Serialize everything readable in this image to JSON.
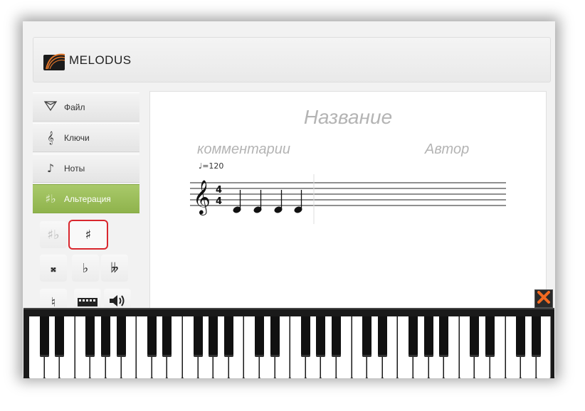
{
  "app": {
    "logo_text": "MELODUS"
  },
  "sidebar": {
    "items": [
      {
        "label": "Файл",
        "icon": "file-icon"
      },
      {
        "label": "Ключи",
        "icon": "treble-clef-icon"
      },
      {
        "label": "Ноты",
        "icon": "note-icon"
      },
      {
        "label": "Альтерация",
        "icon": "alteration-icon",
        "active": true
      }
    ],
    "tools": [
      {
        "name": "natural-alteration-disabled",
        "glyph": "♯♭",
        "disabled": true
      },
      {
        "name": "sharp",
        "glyph": "♯",
        "highlight": true
      },
      {
        "name": "double-sharp",
        "glyph": "𝄪"
      },
      {
        "name": "flat",
        "glyph": "♭"
      },
      {
        "name": "double-flat",
        "glyph": "𝄫"
      },
      {
        "name": "natural",
        "glyph": "♮"
      }
    ]
  },
  "score": {
    "title": "Название",
    "comment": "комментарии",
    "author": "Автор",
    "tempo": "♩=120",
    "time_signature": {
      "top": "4",
      "bottom": "4"
    }
  },
  "colors": {
    "accent_green": "#9bbd56",
    "highlight_red": "#d9272e",
    "close_orange": "#f26a21"
  }
}
